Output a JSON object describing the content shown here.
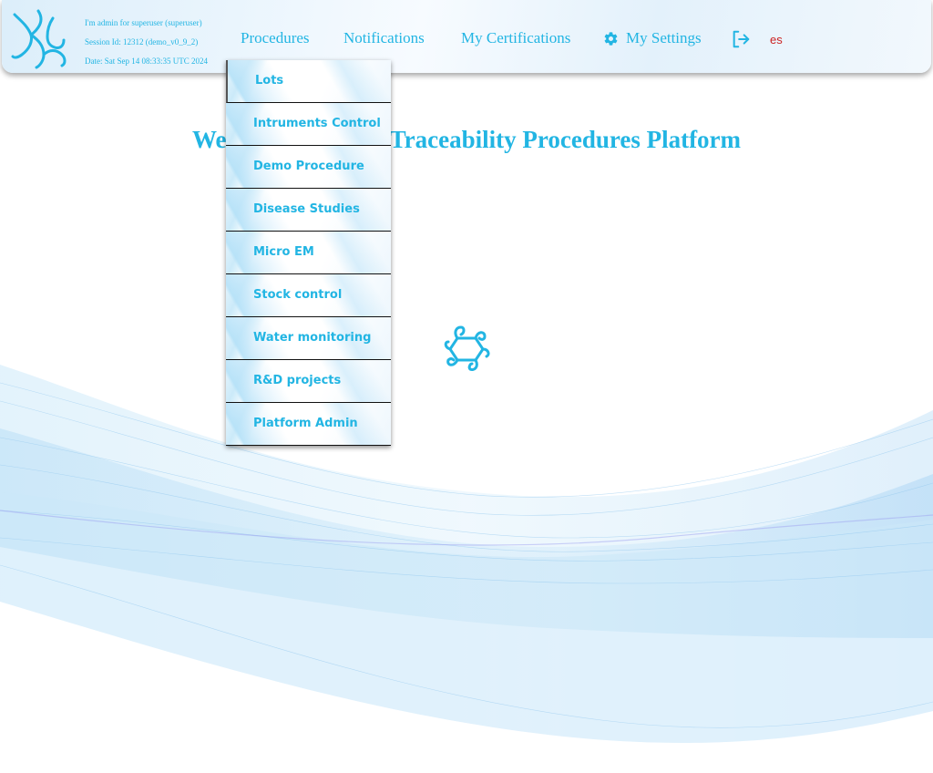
{
  "header": {
    "user_line": "I'm admin for superuser (superuser)",
    "session_line": "Session Id: 12312 (demo_v0_9_2)",
    "date_line": "Date: Sat Sep 14 08:33:35 UTC 2024"
  },
  "nav": {
    "procedures": "Procedures",
    "notifications": "Notifications",
    "certifications": "My Certifications",
    "settings": "My Settings",
    "language": "es"
  },
  "dropdown": {
    "items": [
      {
        "label": "Lots"
      },
      {
        "label": "Intruments Control"
      },
      {
        "label": "Demo Procedure"
      },
      {
        "label": "Disease Studies"
      },
      {
        "label": "Micro EM"
      },
      {
        "label": "Stock control"
      },
      {
        "label": "Water monitoring"
      },
      {
        "label": "R&D projects"
      },
      {
        "label": "Platform Admin"
      }
    ]
  },
  "main": {
    "welcome_title": "Welcome to Trazit Traceability Procedures Platform"
  },
  "colors": {
    "accent": "#22b5e3",
    "language": "#cc2222"
  },
  "icons": {
    "logo": "trazit-logo-icon",
    "settings": "gear-icon",
    "logout": "logout-icon",
    "center": "trazit-logo-icon"
  }
}
